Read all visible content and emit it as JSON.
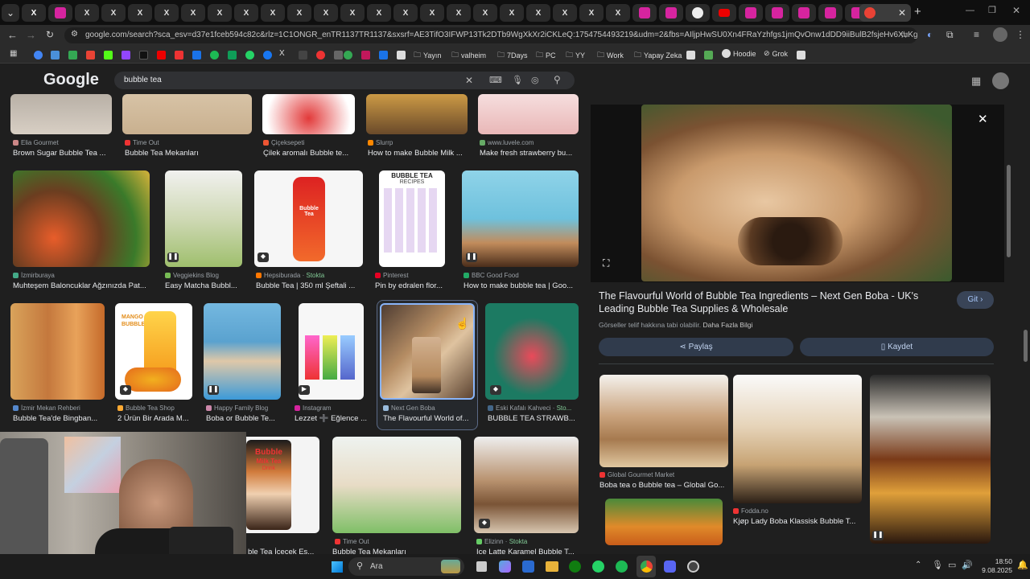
{
  "browser": {
    "url": "google.com/search?sca_esv=d37e1fceb594c82c&rlz=1C1ONGR_enTR1137TR1137&sxsrf=AE3TifO3IFWP13Tk2DTb9WgXkXr2iCKLeQ:1754754493219&udm=2&fbs=AIljpHwSU0Xn4FRaYzhfgs1jmQvOnw1dDD9iiBulB2fsjeHv6XuKgDzU9KpxZMcps...",
    "bookmarks": [
      "Yayın",
      "valheim",
      "7Days",
      "PC",
      "YY",
      "Work",
      "Yapay Zeka",
      "Hoodie",
      "Grok"
    ]
  },
  "search": {
    "logo": "Google",
    "query": "bubble tea"
  },
  "results": [
    {
      "source": "Elia Gourmet",
      "title": "Brown Sugar Bubble Tea ..."
    },
    {
      "source": "Time Out",
      "title": "Bubble Tea Mekanları"
    },
    {
      "source": "Çiçeksepeti",
      "title": "Çilek aromalı Bubble te..."
    },
    {
      "source": "Slurrp",
      "title": "How to make Bubble Milk ..."
    },
    {
      "source": "www.luvele.com",
      "title": "Make fresh strawberry bu..."
    },
    {
      "source": "İzmirburaya",
      "title": "Muhteşem Baloncuklar Ağzınızda Pat..."
    },
    {
      "source": "Veggiekins Blog",
      "title": "Easy Matcha Bubbl..."
    },
    {
      "source": "Hepsiburada",
      "stock": "Stokta",
      "title": "Bubble Tea | 350 ml Şeftali ..."
    },
    {
      "source": "Pinterest",
      "title": "Pin by edralen flor..."
    },
    {
      "source": "BBC Good Food",
      "title": "How to make bubble tea | Goo..."
    },
    {
      "source": "İzmir Mekan Rehberi",
      "title": "Bubble Tea'de Bingban..."
    },
    {
      "source": "Bubble Tea Shop",
      "title": "2 Ürün Bir Arada M..."
    },
    {
      "source": "Happy Family Blog",
      "title": "Boba or Bubble Te..."
    },
    {
      "source": "Instagram",
      "title": "Lezzet ➕ Eğlence ..."
    },
    {
      "source": "Next Gen Boba",
      "title": "The Flavourful World of..."
    },
    {
      "source": "Eski Kafalı Kahveci",
      "stock": "Sto...",
      "title": "BUBBLE TEA STRAWB..."
    },
    {
      "source": "",
      "title": "ble Tea İçecek Es..."
    },
    {
      "source": "Time Out",
      "title": "Bubble Tea Mekanları"
    },
    {
      "source": "Elizinn",
      "stock": "Stokta",
      "title": "Ice Latte Karamel Bubble T..."
    }
  ],
  "thumb_texts": {
    "recipes_title": "BUBBLE TEA",
    "recipes_sub": "RECIPES",
    "can_bubble": "Bubble",
    "can_milktea": "Milk Tea",
    "can_drink": "Drink",
    "mango_1": "MANGO",
    "mango_2": "BUBBLE TEA",
    "bubble_tea_label": "Bubble Tea"
  },
  "panel": {
    "title": "The Flavourful World of Bubble Tea Ingredients – Next Gen Boba - UK's Leading Bubble Tea Supplies & Wholesale",
    "visit": "Git",
    "copyright": "Görseller telif hakkına tabi olabilir.",
    "more_info": "Daha Fazla Bilgi",
    "share": "Paylaş",
    "save": "Kaydet",
    "related": [
      {
        "source": "Global Gourmet Market",
        "title": "Boba tea o Bubble tea – Global Go..."
      },
      {
        "source": "Fodda.no",
        "title": "Kjøp Lady Boba Klassisk Bubble T..."
      }
    ]
  },
  "taskbar": {
    "search_placeholder": "Ara",
    "time": "18:50",
    "date": "9.08.2025"
  },
  "colors": {
    "page_bg": "#1f1f1f",
    "search_bg": "#303134",
    "accent_button": "#394457",
    "selected_border": "#8ab4f8",
    "stock_green": "#81c995"
  }
}
